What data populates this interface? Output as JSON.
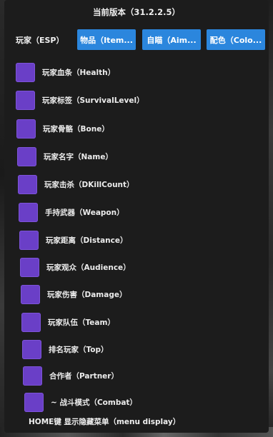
{
  "title": "当前版本（31.2.2.5）",
  "tabs": [
    {
      "label": "玩家（ESP）",
      "active": true
    },
    {
      "label": "物品（Item...",
      "active": false
    },
    {
      "label": "自瞄（Aim...",
      "active": false
    },
    {
      "label": "配色（Colo...",
      "active": false
    }
  ],
  "options": [
    {
      "label": "玩家血条（Health）",
      "checked": true
    },
    {
      "label": "玩家标签（SurvivalLevel）",
      "checked": true
    },
    {
      "label": "玩家骨骼（Bone）",
      "checked": true
    },
    {
      "label": "玩家名字（Name）",
      "checked": true
    },
    {
      "label": "玩家击杀（DKillCount）",
      "checked": true
    },
    {
      "label": "手持武器（Weapon）",
      "checked": true
    },
    {
      "label": "玩家距离（Distance）",
      "checked": true
    },
    {
      "label": "玩家观众（Audience）",
      "checked": true
    },
    {
      "label": "玩家伤害（Damage）",
      "checked": true
    },
    {
      "label": "玩家队伍（Team）",
      "checked": true
    },
    {
      "label": "排名玩家（Top）",
      "checked": true
    },
    {
      "label": "合作者（Partner）",
      "checked": true
    },
    {
      "label": "~ 战斗模式（Combat）",
      "checked": true
    }
  ],
  "footer": "HOME键 显示隐藏菜单（menu display）",
  "colors": {
    "window_bg": "#1c1c1c",
    "tab_blue": "#2b86dd",
    "checkbox_purple": "#6a3fc7"
  }
}
